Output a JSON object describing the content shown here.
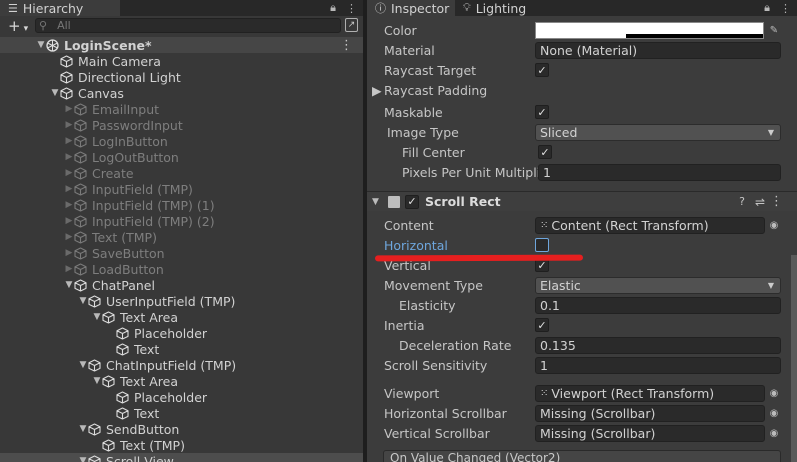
{
  "hierarchy": {
    "tab_label": "Hierarchy",
    "search_placeholder": "All",
    "add_label": "+",
    "scene_name": "LoginScene*",
    "items": [
      {
        "label": "Main Camera",
        "active": true
      },
      {
        "label": "Directional Light",
        "active": true
      },
      {
        "label": "Canvas",
        "active": true
      },
      {
        "label": "EmailInput",
        "active": false
      },
      {
        "label": "PasswordInput",
        "active": false
      },
      {
        "label": "LogInButton",
        "active": false
      },
      {
        "label": "LogOutButton",
        "active": false
      },
      {
        "label": "Create",
        "active": false
      },
      {
        "label": "InputField (TMP)",
        "active": false
      },
      {
        "label": "InputField (TMP) (1)",
        "active": false
      },
      {
        "label": "InputField (TMP) (2)",
        "active": false
      },
      {
        "label": "Text (TMP)",
        "active": false
      },
      {
        "label": "SaveButton",
        "active": false
      },
      {
        "label": "LoadButton",
        "active": false
      },
      {
        "label": "ChatPanel",
        "active": true
      },
      {
        "label": "UserInputField (TMP)",
        "active": true
      },
      {
        "label": "Text Area",
        "active": true
      },
      {
        "label": "Placeholder",
        "active": true
      },
      {
        "label": "Text",
        "active": true
      },
      {
        "label": "ChatInputField (TMP)",
        "active": true
      },
      {
        "label": "Text Area",
        "active": true
      },
      {
        "label": "Placeholder",
        "active": true
      },
      {
        "label": "Text",
        "active": true
      },
      {
        "label": "SendButton",
        "active": true
      },
      {
        "label": "Text (TMP)",
        "active": true
      },
      {
        "label": "Scroll View",
        "active": true
      }
    ]
  },
  "inspector": {
    "tabs": [
      {
        "label": "Inspector"
      },
      {
        "label": "Lighting"
      }
    ],
    "image_fields": {
      "color_label": "Color",
      "material_label": "Material",
      "material_value": "None (Material)",
      "raycast_target_label": "Raycast Target",
      "raycast_padding_label": "Raycast Padding",
      "maskable_label": "Maskable",
      "image_type_label": "Image Type",
      "image_type_value": "Sliced",
      "fill_center_label": "Fill Center",
      "ppu_label": "Pixels Per Unit Multiplier",
      "ppu_value": "1"
    },
    "scroll_rect": {
      "component_name": "Scroll Rect",
      "content_label": "Content",
      "content_value": "Content (Rect Transform)",
      "horizontal_label": "Horizontal",
      "vertical_label": "Vertical",
      "movement_type_label": "Movement Type",
      "movement_type_value": "Elastic",
      "elasticity_label": "Elasticity",
      "elasticity_value": "0.1",
      "inertia_label": "Inertia",
      "deceleration_label": "Deceleration Rate",
      "deceleration_value": "0.135",
      "scroll_sensitivity_label": "Scroll Sensitivity",
      "scroll_sensitivity_value": "1",
      "viewport_label": "Viewport",
      "viewport_value": "Viewport (Rect Transform)",
      "h_scrollbar_label": "Horizontal Scrollbar",
      "h_scrollbar_value": "Missing (Scrollbar)",
      "v_scrollbar_label": "Vertical Scrollbar",
      "v_scrollbar_value": "Missing (Scrollbar)",
      "event_label": "On Value Changed (Vector2)"
    }
  },
  "colors": {
    "annotation_red": "#e61f1f",
    "link_blue": "#6ea6dd"
  }
}
